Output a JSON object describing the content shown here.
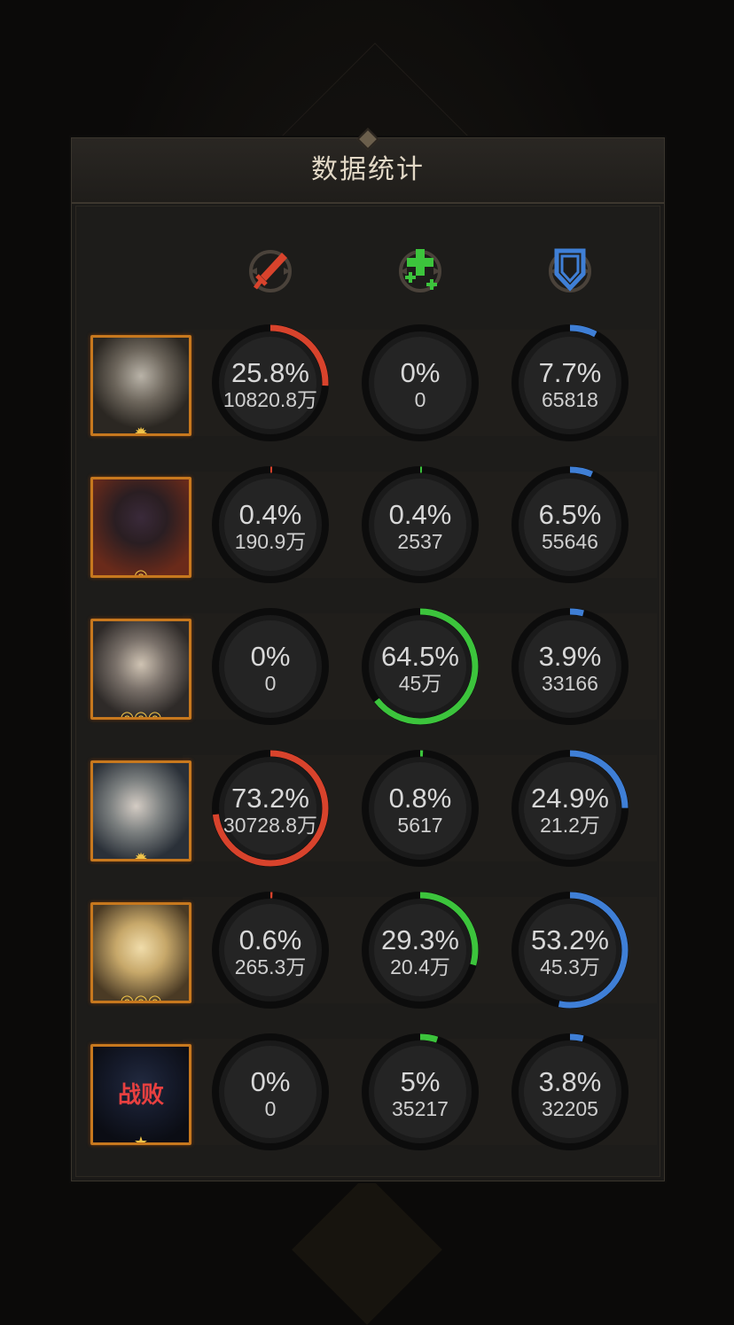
{
  "title": "数据统计",
  "columns": [
    {
      "name": "damage",
      "icon": "sword-icon",
      "color": "#d8432c"
    },
    {
      "name": "heal",
      "icon": "heal-cross-icon",
      "color": "#3cc43c"
    },
    {
      "name": "tank",
      "icon": "shield-icon",
      "color": "#3f7fd6"
    }
  ],
  "heroes": [
    {
      "id": "hero1",
      "defeated": false,
      "badge": "✹",
      "stats": [
        {
          "pct": "25.8%",
          "value": "10820.8万",
          "frac": 0.258
        },
        {
          "pct": "0%",
          "value": "0",
          "frac": 0
        },
        {
          "pct": "7.7%",
          "value": "65818",
          "frac": 0.077
        }
      ]
    },
    {
      "id": "hero2",
      "defeated": false,
      "badge": "◎",
      "stats": [
        {
          "pct": "0.4%",
          "value": "190.9万",
          "frac": 0.004
        },
        {
          "pct": "0.4%",
          "value": "2537",
          "frac": 0.004
        },
        {
          "pct": "6.5%",
          "value": "55646",
          "frac": 0.065
        }
      ]
    },
    {
      "id": "hero3",
      "defeated": false,
      "badge": "◎◎◎",
      "stats": [
        {
          "pct": "0%",
          "value": "0",
          "frac": 0
        },
        {
          "pct": "64.5%",
          "value": "45万",
          "frac": 0.645
        },
        {
          "pct": "3.9%",
          "value": "33166",
          "frac": 0.039
        }
      ]
    },
    {
      "id": "hero4",
      "defeated": false,
      "badge": "✹",
      "stats": [
        {
          "pct": "73.2%",
          "value": "30728.8万",
          "frac": 0.732
        },
        {
          "pct": "0.8%",
          "value": "5617",
          "frac": 0.008
        },
        {
          "pct": "24.9%",
          "value": "21.2万",
          "frac": 0.249
        }
      ]
    },
    {
      "id": "hero5",
      "defeated": false,
      "badge": "◎◎◎",
      "stats": [
        {
          "pct": "0.6%",
          "value": "265.3万",
          "frac": 0.006
        },
        {
          "pct": "29.3%",
          "value": "20.4万",
          "frac": 0.293
        },
        {
          "pct": "53.2%",
          "value": "45.3万",
          "frac": 0.532
        }
      ]
    },
    {
      "id": "hero6",
      "defeated": true,
      "defeat_label": "战败",
      "badge": "★",
      "stats": [
        {
          "pct": "0%",
          "value": "0",
          "frac": 0
        },
        {
          "pct": "5%",
          "value": "35217",
          "frac": 0.05
        },
        {
          "pct": "3.8%",
          "value": "32205",
          "frac": 0.038
        }
      ]
    }
  ]
}
